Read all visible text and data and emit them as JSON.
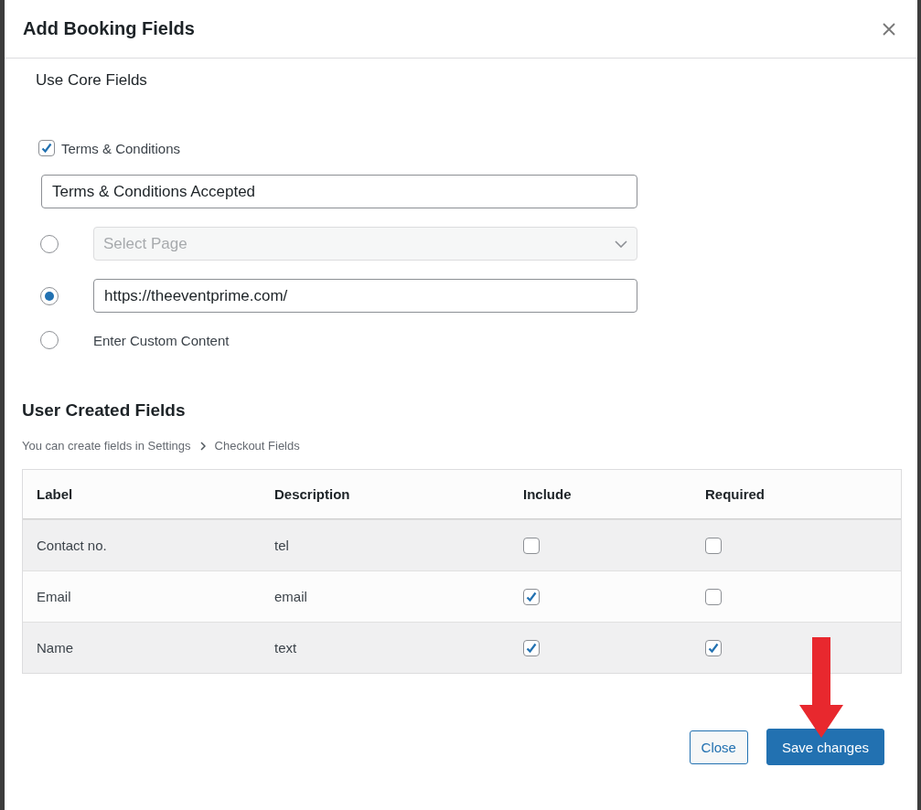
{
  "dialog": {
    "title": "Add Booking Fields"
  },
  "core_fields": {
    "heading": "Use Core Fields",
    "terms": {
      "label": "Terms & Conditions",
      "checked": true
    },
    "terms_text": {
      "value": "Terms & Conditions Accepted"
    },
    "options": [
      {
        "kind": "select",
        "selected": false,
        "placeholder": "Select Page"
      },
      {
        "kind": "input",
        "selected": true,
        "value": "https://theeventprime.com/"
      },
      {
        "kind": "text",
        "selected": false,
        "label": "Enter Custom Content"
      }
    ]
  },
  "user_fields": {
    "heading": "User Created Fields",
    "breadcrumb": [
      "You can create fields in Settings",
      "Checkout Fields"
    ],
    "table": {
      "columns": [
        "Label",
        "Description",
        "Include",
        "Required"
      ],
      "rows": [
        {
          "label": "Contact no.",
          "description": "tel",
          "include": false,
          "required": false
        },
        {
          "label": "Email",
          "description": "email",
          "include": true,
          "required": false
        },
        {
          "label": "Name",
          "description": "text",
          "include": true,
          "required": true
        }
      ]
    }
  },
  "buttons": [
    {
      "label": "Close",
      "kind": "secondary"
    },
    {
      "label": "Save changes",
      "kind": "primary"
    }
  ]
}
